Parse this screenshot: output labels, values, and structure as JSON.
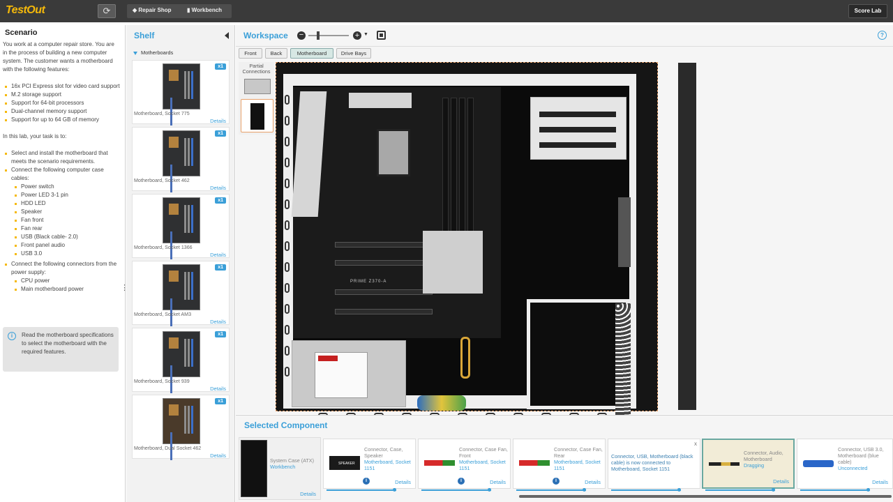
{
  "topbar": {
    "logo": "TestOut",
    "crumbs": [
      "Repair Shop",
      "Workbench"
    ],
    "score_lab": "Score Lab"
  },
  "scenario": {
    "title": "Scenario",
    "intro": "You work at a computer repair store. You are in the process of building a new computer system. The customer wants a motherboard with the following features:",
    "features": [
      "16x PCI Express slot for video card support",
      "M.2 storage support",
      "Support for 64-bit processors",
      "Dual-channel memory support",
      "Support for up to 64 GB of memory"
    ],
    "task_intro": "In this lab, your task is to:",
    "task1": "Select and install the motherboard that meets the scenario requirements.",
    "task2": "Connect the following computer case cables:",
    "cables": [
      "Power switch",
      "Power LED 3-1 pin",
      "HDD LED",
      "Speaker",
      "Fan front",
      "Fan rear",
      "USB (Black cable- 2.0)",
      "Front panel audio",
      "USB 3.0"
    ],
    "task3": "Connect the following connectors from the power supply:",
    "power": [
      "CPU power",
      "Main motherboard power"
    ],
    "hint": "Read the motherboard specifications to select the motherboard with the required features."
  },
  "shelf": {
    "title": "Shelf",
    "category": "Motherboards",
    "items": [
      {
        "name": "Motherboard, Socket 775",
        "qty": "x1",
        "details": "Details"
      },
      {
        "name": "Motherboard, Socket 462",
        "qty": "x1",
        "details": "Details"
      },
      {
        "name": "Motherboard, Socket 1366",
        "qty": "x1",
        "details": "Details"
      },
      {
        "name": "Motherboard, Socket AM3",
        "qty": "x1",
        "details": "Details"
      },
      {
        "name": "Motherboard, Socket 939",
        "qty": "x1",
        "details": "Details"
      },
      {
        "name": "Motherboard, Dual Socket 462",
        "qty": "x1",
        "details": "Details"
      }
    ]
  },
  "workspace": {
    "title": "Workspace",
    "tabs": [
      "Front",
      "Back",
      "Motherboard",
      "Drive Bays"
    ],
    "active_tab": "Motherboard",
    "partial_label": "Partial Connections",
    "zoom_level": 0.2,
    "board_label": "PRIME Z370-A"
  },
  "selected": {
    "title": "Selected Component",
    "case": {
      "name": "System Case (ATX)",
      "location": "Workbench",
      "details": "Details"
    },
    "cards": [
      {
        "name": "Connector, Case, Speaker",
        "status": "Motherboard, Socket 1151",
        "details": "Details",
        "pic_label": "SPEAKER"
      },
      {
        "name": "Connector, Case Fan, Front",
        "status": "Motherboard, Socket 1151",
        "details": "Details"
      },
      {
        "name": "Connector, Case Fan, Rear",
        "status": "Motherboard, Socket 1151",
        "details": "Details"
      },
      {
        "message": "Connector, USB, Motherboard (black cable) is now connected to Motherboard, Socket 1151",
        "close": "x"
      },
      {
        "name": "Connector, Audio, Motherboard",
        "status": "Dragging",
        "details": "Details"
      },
      {
        "name": "Connector, USB 3.0, Motherboard (blue cable)",
        "status": "Unconnected",
        "details": "Details"
      }
    ]
  },
  "colors": {
    "accent": "#3a9fd8",
    "logo": "#f5b90a",
    "topbar": "#3a3a3a",
    "selection": "#e8a16a"
  }
}
